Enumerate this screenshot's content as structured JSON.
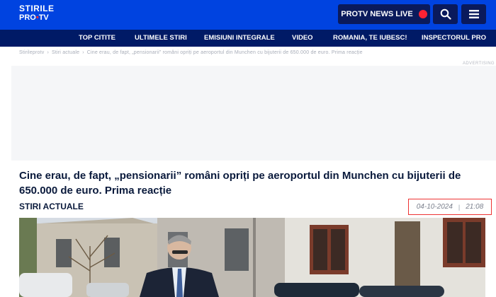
{
  "header": {
    "logo_line1": "STIRILE",
    "logo_line2_a": "PRO",
    "logo_line2_b": "TV",
    "live_label": "PROTV NEWS LIVE"
  },
  "nav": {
    "items": [
      "TOP CITITE",
      "ULTIMELE STIRI",
      "EMISIUNI INTEGRALE",
      "VIDEO",
      "ROMANIA, TE IUBESC!",
      "INSPECTORUL PRO"
    ]
  },
  "breadcrumb": {
    "home": "Stirileprotv",
    "section": "Stiri actuale",
    "current": "Cine erau, de fapt, „pensionarii” români opriți pe aeroportul din Munchen cu bijuterii de 650.000 de euro. Prima reacție"
  },
  "ad": {
    "label": "ADVERTISING"
  },
  "article": {
    "headline": "Cine erau, de fapt, „pensionarii” români opriți pe aeroportul din Munchen cu bijuterii de 650.000 de euro. Prima reacție",
    "category": "STIRI ACTUALE",
    "date": "04-10-2024",
    "separator": "|",
    "time": "21:08"
  },
  "colors": {
    "header_blue": "#0043e0",
    "nav_dark": "#001a66",
    "live_dot": "#ff2233",
    "date_border": "#ee3333"
  }
}
